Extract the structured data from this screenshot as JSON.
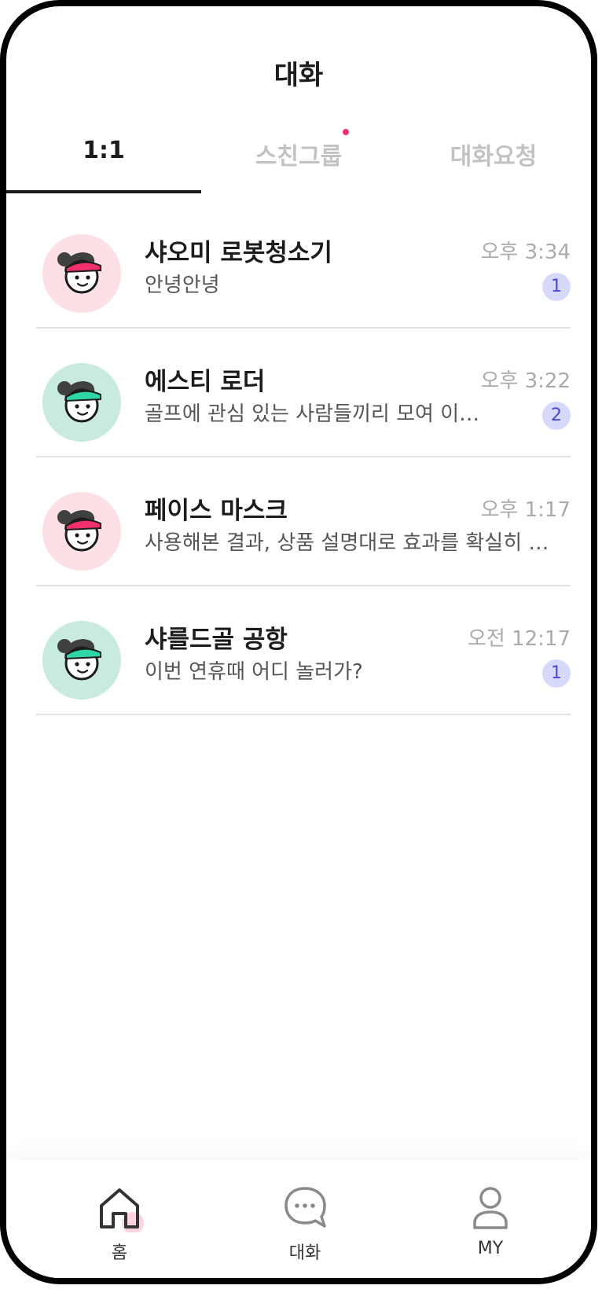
{
  "header": {
    "title": "대화"
  },
  "tabs": [
    {
      "label": "1:1",
      "active": true
    },
    {
      "label": "스친그룹",
      "has_dot": true
    },
    {
      "label": "대화요청"
    }
  ],
  "chats": [
    {
      "name": "샤오미 로봇청소기",
      "preview": "안녕안녕",
      "time": "오후 3:34",
      "badge": "1",
      "avatar_variant": "pink"
    },
    {
      "name": "에스티 로더",
      "preview": "골프에 관심 있는 사람들끼리 모여 이런…",
      "time": "오후 3:22",
      "badge": "2",
      "avatar_variant": "mint"
    },
    {
      "name": "페이스 마스크",
      "preview": "사용해본 결과, 상품 설명대로 효과를 확실히 효…",
      "time": "오후 1:17",
      "badge": "",
      "avatar_variant": "pink"
    },
    {
      "name": "샤를드골 공항",
      "preview": "이번 연휴때 어디 놀러가?",
      "time": "오전 12:17",
      "badge": "1",
      "avatar_variant": "mint"
    }
  ],
  "bottom_nav": [
    {
      "label": "홈",
      "icon": "home-icon"
    },
    {
      "label": "대화",
      "icon": "chat-bubble-icon"
    },
    {
      "label": "MY",
      "icon": "user-icon"
    }
  ],
  "colors": {
    "accent_pink": "#f0316b",
    "avatar_pink_bg": "#fde0e6",
    "avatar_mint_bg": "#c8eae0",
    "badge_bg": "#d7d9fa",
    "badge_text": "#4848d0"
  }
}
